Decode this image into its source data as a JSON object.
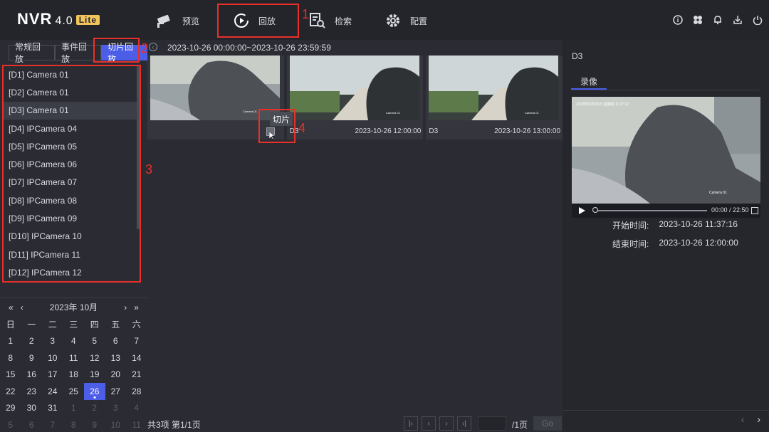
{
  "app": {
    "logo": "NVR",
    "version": "4.0",
    "edition": "Lite"
  },
  "nav": {
    "items": [
      {
        "label": "预览",
        "icon": "camera-icon"
      },
      {
        "label": "回放",
        "icon": "playback-icon"
      },
      {
        "label": "检索",
        "icon": "search-file-icon"
      },
      {
        "label": "配置",
        "icon": "gear-icon"
      }
    ]
  },
  "top_icons": [
    "info-icon",
    "fan-icon",
    "bell-icon",
    "download-icon",
    "power-icon"
  ],
  "annotations": [
    "1",
    "2",
    "3",
    "4"
  ],
  "left": {
    "tabs": [
      "常规回放",
      "事件回放",
      "切片回放"
    ],
    "active_tab": 2,
    "cameras": [
      "[D1] Camera 01",
      "[D2] Camera 01",
      "[D3] Camera 01",
      "[D4] IPCamera 04",
      "[D5] IPCamera 05",
      "[D6] IPCamera 06",
      "[D7] IPCamera 07",
      "[D8] IPCamera 08",
      "[D9] IPCamera 09",
      "[D10] IPCamera 10",
      "[D11] IPCamera 11",
      "[D12] IPCamera 12"
    ],
    "selected_camera": 2
  },
  "calendar": {
    "title": "2023年 10月",
    "nav": {
      "prev_year": "«",
      "prev_month": "‹",
      "next_month": "›",
      "next_year": "»"
    },
    "weekdays": [
      "日",
      "一",
      "二",
      "三",
      "四",
      "五",
      "六"
    ],
    "days": [
      "1",
      "2",
      "3",
      "4",
      "5",
      "6",
      "7",
      "8",
      "9",
      "10",
      "11",
      "12",
      "13",
      "14",
      "15",
      "16",
      "17",
      "18",
      "19",
      "20",
      "21",
      "22",
      "23",
      "24",
      "25",
      "26",
      "27",
      "28",
      "29",
      "30",
      "31",
      "1",
      "2",
      "3",
      "4",
      "5",
      "6",
      "7",
      "8",
      "9",
      "10",
      "11"
    ],
    "selected": "26"
  },
  "center": {
    "range": "2023-10-26 00:00:00~2023-10-26 23:59:59",
    "clips": [
      {
        "channel": "",
        "time": ""
      },
      {
        "channel": "D3",
        "time": "2023-10-26 12:00:00"
      },
      {
        "channel": "D3",
        "time": "2023-10-26 13:00:00"
      }
    ],
    "tooltip": "切片",
    "footer": {
      "total": "共3项 第1/1页",
      "page_value": "",
      "page_total": "/1页",
      "go": "Go"
    }
  },
  "right": {
    "title": "D3",
    "tab": "录像",
    "video_overlay": "2023年10月26日 星期四 11:37:12",
    "camera_label": "Camera 01",
    "time": "00:00 / 22:50",
    "progress": 0.0,
    "start_label": "开始时间:",
    "start_value": "2023-10-26 11:37:16",
    "end_label": "结束时间:",
    "end_value": "2023-10-26 12:00:00"
  }
}
